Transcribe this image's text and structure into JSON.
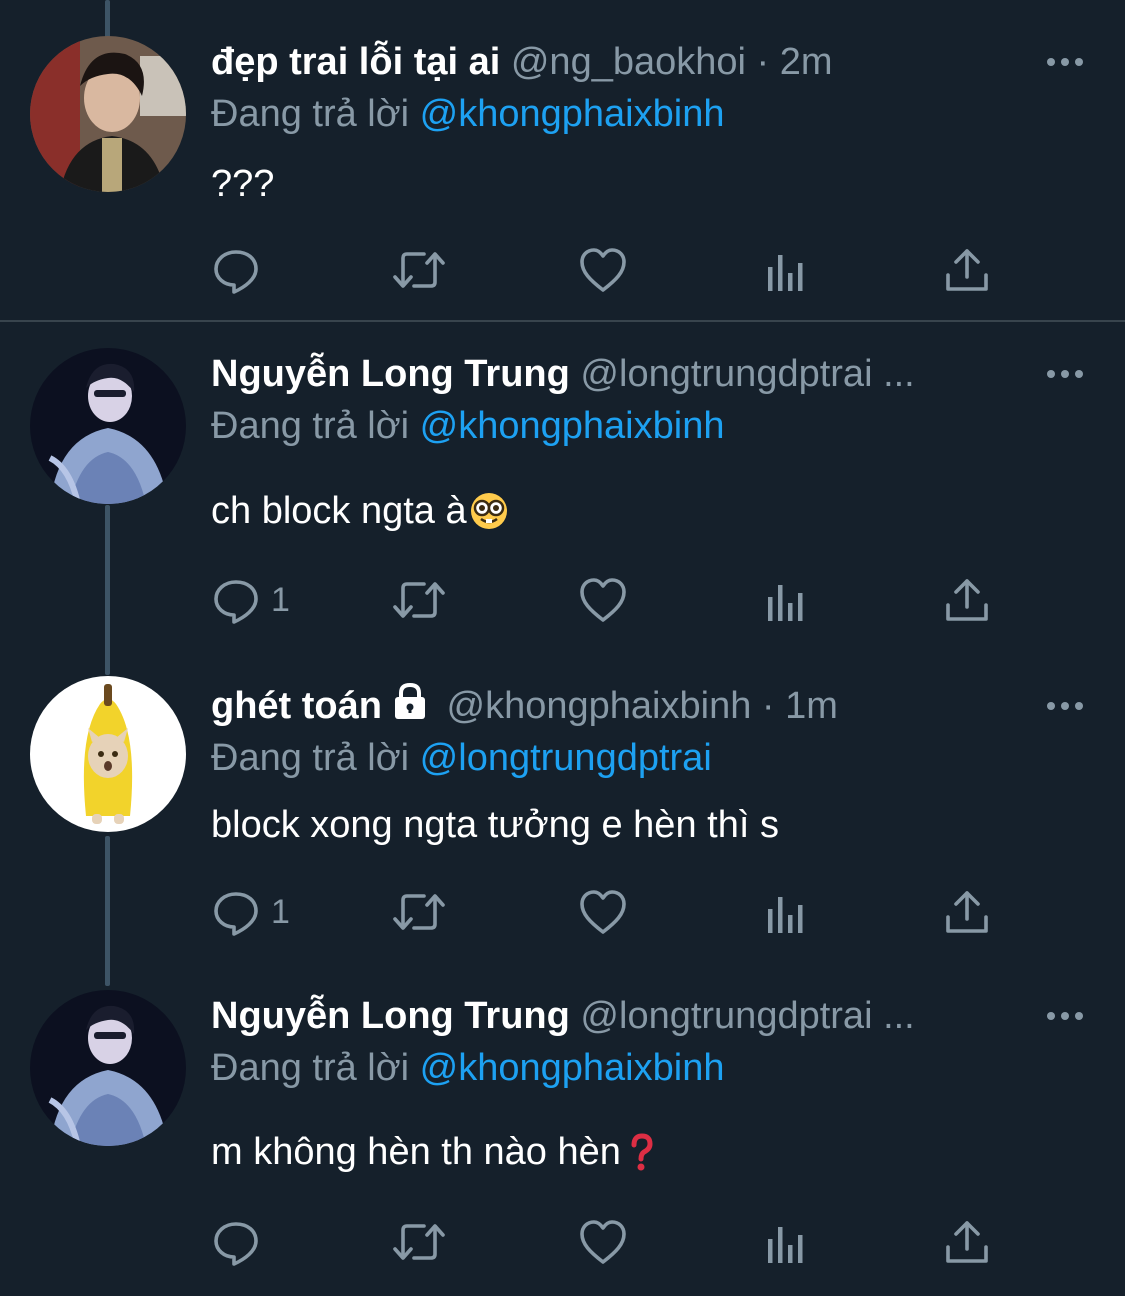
{
  "tweets": [
    {
      "display_name": "đẹp trai lỗi tại ai",
      "handle": "@ng_baokhoi",
      "separator": "·",
      "time": "2m",
      "reply_prefix": "Đang trả lời",
      "reply_to": "@khongphaixbinh",
      "text": "???",
      "reply_count": "",
      "avatar": "avatar-ng-baokhoi"
    },
    {
      "display_name": "Nguyễn Long Trung",
      "handle": "@longtrungdptrai ...",
      "separator": "",
      "time": "",
      "reply_prefix": "Đang trả lời",
      "reply_to": "@khongphaixbinh",
      "text": "ch block ngta à",
      "emoji": "nerd-face-emoji",
      "reply_count": "1",
      "avatar": "avatar-longtrungdptrai"
    },
    {
      "display_name": "ghét toán",
      "protected_icon": "lock-icon",
      "handle": "@khongphaixbinh",
      "separator": "·",
      "time": "1m",
      "reply_prefix": "Đang trả lời",
      "reply_to": "@longtrungdptrai",
      "text": "block xong ngta tưởng e hèn thì s",
      "reply_count": "1",
      "avatar": "avatar-banana-cat"
    },
    {
      "display_name": "Nguyễn Long Trung",
      "handle": "@longtrungdptrai ...",
      "separator": "",
      "time": "",
      "reply_prefix": "Đang trả lời",
      "reply_to": "@khongphaixbinh",
      "text": "m không hèn th nào hèn",
      "emoji": "red-question-mark-emoji",
      "reply_count": "",
      "avatar": "avatar-longtrungdptrai"
    }
  ],
  "action_icons": [
    "reply-icon",
    "retweet-icon",
    "like-icon",
    "analytics-icon",
    "share-icon"
  ],
  "more_icon": "more-icon",
  "colors": {
    "background": "#15202b",
    "text_primary": "#ffffff",
    "text_secondary": "#8899a6",
    "link": "#1da1f2",
    "divider": "#38444d",
    "thread_line": "#3d5466"
  }
}
